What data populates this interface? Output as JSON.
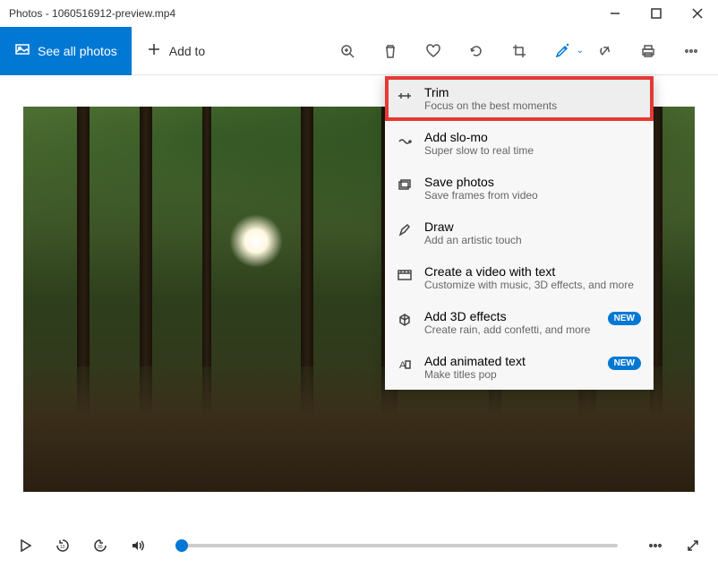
{
  "window": {
    "title": "Photos - 1060516912-preview.mp4"
  },
  "toolbar": {
    "see_all_label": "See all photos",
    "add_to_label": "Add to"
  },
  "dropdown": {
    "items": [
      {
        "title": "Trim",
        "sub": "Focus on the best moments",
        "icon": "trim-icon",
        "highlighted": true
      },
      {
        "title": "Add slo-mo",
        "sub": "Super slow to real time",
        "icon": "slomo-icon"
      },
      {
        "title": "Save photos",
        "sub": "Save frames from video",
        "icon": "save-photos-icon"
      },
      {
        "title": "Draw",
        "sub": "Add an artistic touch",
        "icon": "draw-icon"
      },
      {
        "title": "Create a video with text",
        "sub": "Customize with music, 3D effects, and more",
        "icon": "video-text-icon"
      },
      {
        "title": "Add 3D effects",
        "sub": "Create rain, add confetti, and more",
        "icon": "effects-3d-icon",
        "badge": "NEW"
      },
      {
        "title": "Add animated text",
        "sub": "Make titles pop",
        "icon": "animated-text-icon",
        "badge": "NEW"
      }
    ]
  }
}
